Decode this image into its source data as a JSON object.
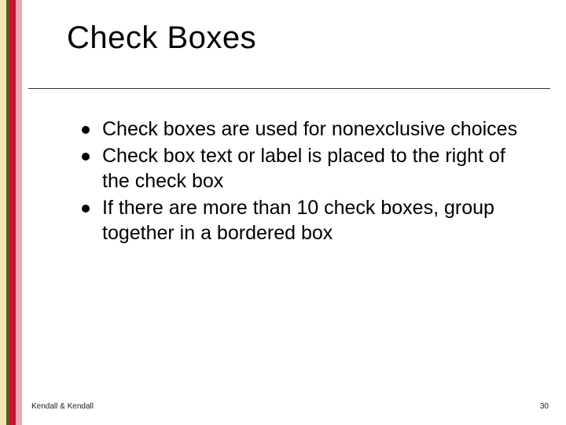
{
  "slide": {
    "title": "Check Boxes",
    "bullets": [
      "Check boxes are used for nonexclusive choices",
      "Check box text or label is placed to the right of the check box",
      "If there are more than 10 check boxes, group together in a bordered box"
    ],
    "footer_left": "Kendall & Kendall",
    "footer_right": "30"
  }
}
